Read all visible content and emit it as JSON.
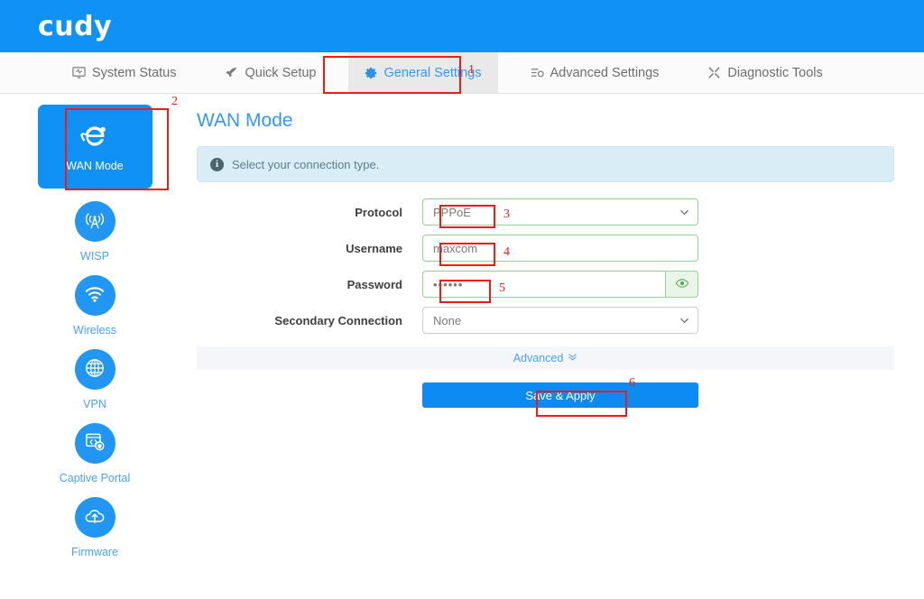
{
  "header": {
    "logo": "cudy"
  },
  "nav": {
    "items": [
      {
        "label": "System Status",
        "icon": "monitor-icon",
        "active": false
      },
      {
        "label": "Quick Setup",
        "icon": "rocket-icon",
        "active": false
      },
      {
        "label": "General Settings",
        "icon": "gear-icon",
        "active": true
      },
      {
        "label": "Advanced Settings",
        "icon": "sliders-icon",
        "active": false
      },
      {
        "label": "Diagnostic Tools",
        "icon": "tools-icon",
        "active": false
      }
    ]
  },
  "sidebar": {
    "items": [
      {
        "label": "WAN Mode",
        "icon": "internet-explorer-e-icon",
        "active": true
      },
      {
        "label": "WISP",
        "icon": "radio-tower-icon",
        "active": false
      },
      {
        "label": "Wireless",
        "icon": "wifi-icon",
        "active": false
      },
      {
        "label": "VPN",
        "icon": "globe-icon",
        "active": false
      },
      {
        "label": "Captive Portal",
        "icon": "portal-browser-icon",
        "active": false
      },
      {
        "label": "Firmware",
        "icon": "cloud-upload-icon",
        "active": false
      }
    ]
  },
  "main": {
    "title": "WAN Mode",
    "info_text": "Select your connection type.",
    "fields": {
      "protocol": {
        "label": "Protocol",
        "value": "PPPoE"
      },
      "username": {
        "label": "Username",
        "value": "maxcom"
      },
      "password": {
        "label": "Password",
        "value": "••••••"
      },
      "secondary": {
        "label": "Secondary Connection",
        "value": "None"
      }
    },
    "advanced_label": "Advanced",
    "advanced_chevron": "⌄",
    "save_label": "Save & Apply"
  },
  "annotations": {
    "numbers": [
      "1",
      "2",
      "3",
      "4",
      "5",
      "6"
    ]
  },
  "colors": {
    "brand_blue": "#1091f5",
    "link_blue": "#3498f3",
    "annotation_red": "#ee1b1b",
    "field_green": "#9ad09a",
    "info_bg": "#d9edf7"
  }
}
